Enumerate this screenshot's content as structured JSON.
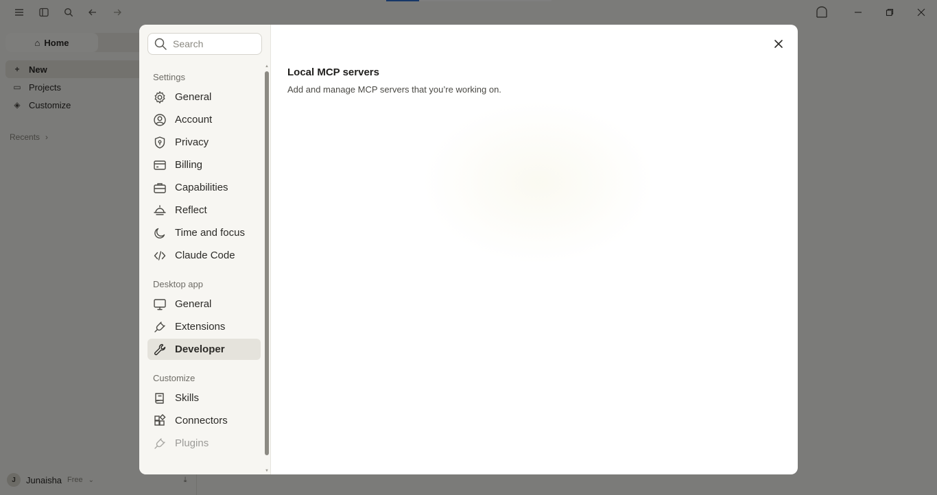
{
  "app": {
    "title_icons": [
      "menu-icon",
      "sidebar-toggle-icon",
      "search-icon",
      "back-icon",
      "forward-icon"
    ],
    "segment": {
      "home_label": "Home",
      "other_label": ""
    },
    "nav": [
      {
        "label": "New",
        "icon": "plus-icon"
      },
      {
        "label": "Projects",
        "icon": "folder-icon"
      },
      {
        "label": "Customize",
        "icon": "palette-icon"
      }
    ],
    "recents_label": "Recents",
    "user": {
      "initial": "J",
      "name": "Junaisha",
      "plan": "Free"
    }
  },
  "modal": {
    "search": {
      "placeholder": "Search",
      "value": ""
    },
    "sections": {
      "settings": "Settings",
      "desktop": "Desktop app",
      "customize": "Customize"
    },
    "settings_items": [
      {
        "label": "General",
        "icon": "gear-icon"
      },
      {
        "label": "Account",
        "icon": "user-circle-icon"
      },
      {
        "label": "Privacy",
        "icon": "shield-icon"
      },
      {
        "label": "Billing",
        "icon": "credit-card-icon"
      },
      {
        "label": "Capabilities",
        "icon": "briefcase-icon"
      },
      {
        "label": "Reflect",
        "icon": "sunrise-icon"
      },
      {
        "label": "Time and focus",
        "icon": "moon-icon"
      },
      {
        "label": "Claude Code",
        "icon": "code-icon"
      }
    ],
    "desktop_items": [
      {
        "label": "General",
        "icon": "monitor-icon"
      },
      {
        "label": "Extensions",
        "icon": "plug-icon"
      },
      {
        "label": "Developer",
        "icon": "wrench-icon",
        "active": true
      }
    ],
    "customize_items": [
      {
        "label": "Skills",
        "icon": "book-icon"
      },
      {
        "label": "Connectors",
        "icon": "blocks-icon"
      },
      {
        "label": "Plugins",
        "icon": "plug-icon"
      }
    ],
    "main": {
      "title": "Local MCP servers",
      "subtitle": "Add and manage MCP servers that you’re working on."
    }
  }
}
